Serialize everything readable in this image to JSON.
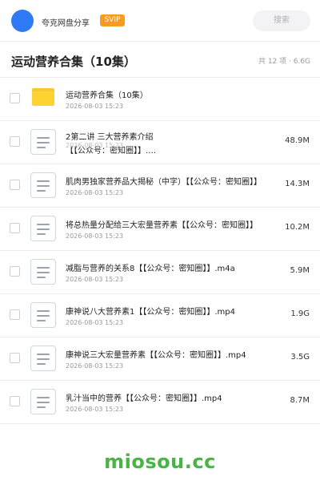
{
  "header": {
    "app_name": "夸克网盘分享",
    "badge": "SVIP",
    "search_placeholder": "搜索"
  },
  "folder": {
    "title": "运动营养合集（10集）",
    "summary": "共 12 项 · 6.6G"
  },
  "items": [
    {
      "type": "folder",
      "icon": "folder-icon",
      "name": "运动营养合集（10集）",
      "date": "2026-08-03 15:23",
      "size": ""
    },
    {
      "type": "file",
      "icon": "document-icon",
      "name": "2第二讲 三大营养素介绍\n【【公众号：密知圈】】.…",
      "date": "2026-08-03 15:23",
      "size": "48.9M"
    },
    {
      "type": "file",
      "icon": "document-icon",
      "name": "肌肉男独家营养品大揭秘（中字）【【公众号：密知圈】】",
      "date": "2026-08-03 15:23",
      "size": "14.3M"
    },
    {
      "type": "file",
      "icon": "document-icon",
      "name": "将总热量分配给三大宏量营养素【【公众号：密知圈】】",
      "date": "2026-08-03 15:23",
      "size": "10.2M"
    },
    {
      "type": "file",
      "icon": "document-icon",
      "name": "减脂与营养的关系8【【公众号：密知圈】】.m4a",
      "date": "2026-08-03 15:23",
      "size": "5.9M"
    },
    {
      "type": "file",
      "icon": "document-icon",
      "name": "康神说八大营养素1【【公众号：密知圈】】.mp4",
      "date": "2026-08-03 15:23",
      "size": "1.9G"
    },
    {
      "type": "file",
      "icon": "document-icon",
      "name": "康神说三大宏量营养素【【公众号：密知圈】】.mp4",
      "date": "2026-08-03 15:23",
      "size": "3.5G"
    },
    {
      "type": "file",
      "icon": "document-icon",
      "name": "乳汁当中的营养【【公众号：密知圈】】.mp4",
      "date": "2026-08-03 15:23",
      "size": "8.7M"
    }
  ],
  "watermark": "miosou.cc",
  "colors": {
    "brand_blue": "#2f7bf6",
    "svip_orange": "#f59d21",
    "folder_yellow": "#ffd233",
    "watermark_green": "#46b543"
  }
}
